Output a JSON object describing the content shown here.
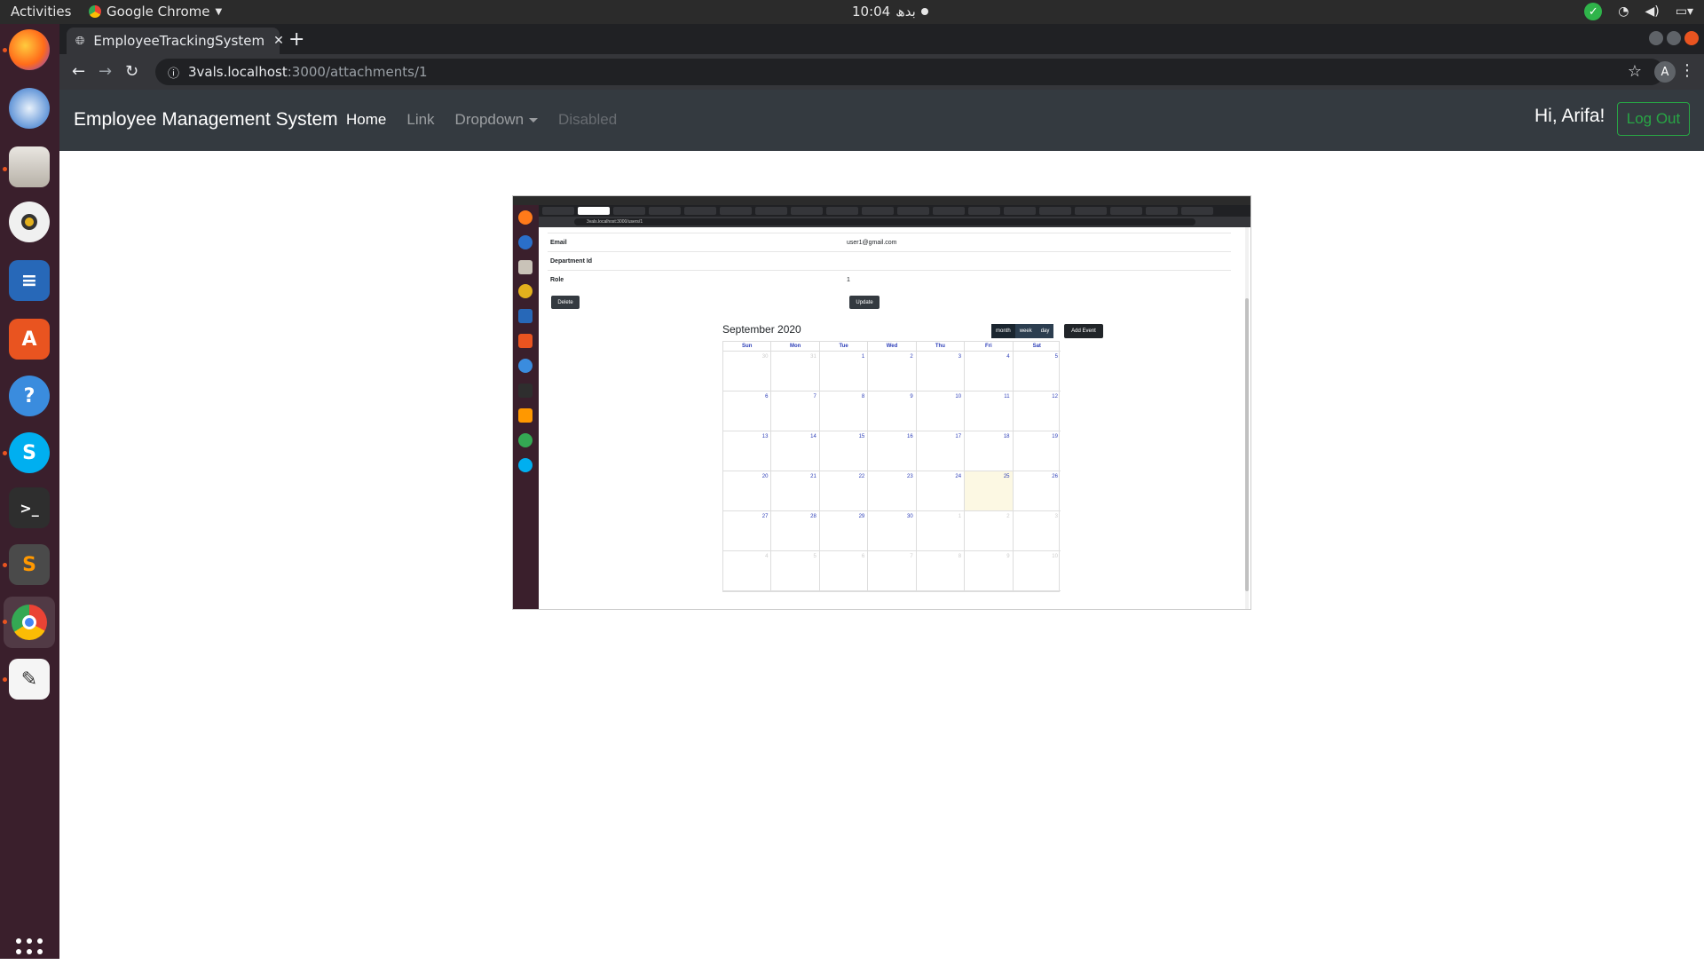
{
  "os": {
    "activities": "Activities",
    "app_menu": "Google Chrome",
    "clock": "10:04",
    "clock_suffix": "بدھ"
  },
  "dock": {
    "apps": [
      "firefox",
      "thunderbird",
      "files",
      "rhythmbox",
      "libreoffice-writer",
      "ubuntu-software",
      "help",
      "skype",
      "terminal",
      "sublime-text",
      "chrome",
      "text-editor"
    ]
  },
  "browser": {
    "tab_title": "EmployeeTrackingSystem",
    "url_host": "3vals.localhost",
    "url_path": ":3000/attachments/1",
    "profile_initial": "A"
  },
  "navbar": {
    "brand": "Employee Management System",
    "links": {
      "home": "Home",
      "link": "Link",
      "dropdown": "Dropdown",
      "disabled": "Disabled"
    },
    "greeting": "Hi, Arifa!",
    "logout": "Log Out"
  },
  "attachment": {
    "url": "3vals.localhost:3000/users/1",
    "rows": [
      {
        "key": "Email",
        "value": "user1@gmail.com"
      },
      {
        "key": "Department Id",
        "value": ""
      },
      {
        "key": "Role",
        "value": "1"
      }
    ],
    "delete_label": "Delete",
    "update_label": "Update",
    "calendar": {
      "title": "September 2020",
      "views": [
        "month",
        "week",
        "day"
      ],
      "active_view": "month",
      "add_event": "Add Event",
      "weekdays": [
        "Sun",
        "Mon",
        "Tue",
        "Wed",
        "Thu",
        "Fri",
        "Sat"
      ],
      "weeks": [
        [
          "30",
          "31",
          "1",
          "2",
          "3",
          "4",
          "5"
        ],
        [
          "6",
          "7",
          "8",
          "9",
          "10",
          "11",
          "12"
        ],
        [
          "13",
          "14",
          "15",
          "16",
          "17",
          "18",
          "19"
        ],
        [
          "20",
          "21",
          "22",
          "23",
          "24",
          "25",
          "26"
        ],
        [
          "27",
          "28",
          "29",
          "30",
          "1",
          "2",
          "3"
        ],
        [
          "4",
          "5",
          "6",
          "7",
          "8",
          "9",
          "10"
        ]
      ],
      "today": "25"
    }
  }
}
